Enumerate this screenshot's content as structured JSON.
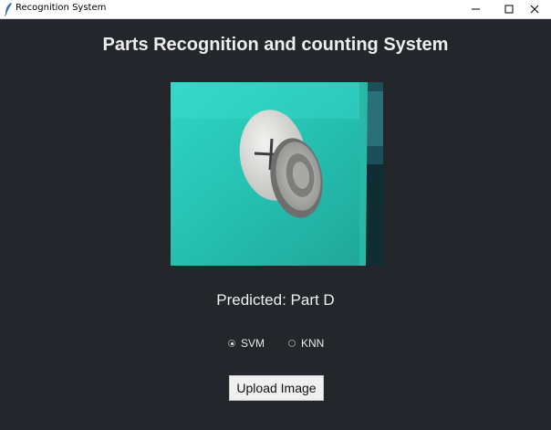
{
  "window": {
    "title": "Recognition System",
    "icon": "feather-icon",
    "controls": [
      "minimize-icon",
      "maximize-icon",
      "close-icon"
    ]
  },
  "main": {
    "heading": "Parts Recognition and counting System",
    "prediction_text": "Predicted: Part D",
    "classifier_options": [
      {
        "label": "SVM",
        "selected": true
      },
      {
        "label": "KNN",
        "selected": false
      }
    ],
    "upload_button_label": "Upload Image"
  },
  "colors": {
    "background": "#23262a",
    "titlebar": "#ffffff",
    "text": "#eeeeee",
    "photo_teal": "#2ec9bc"
  }
}
